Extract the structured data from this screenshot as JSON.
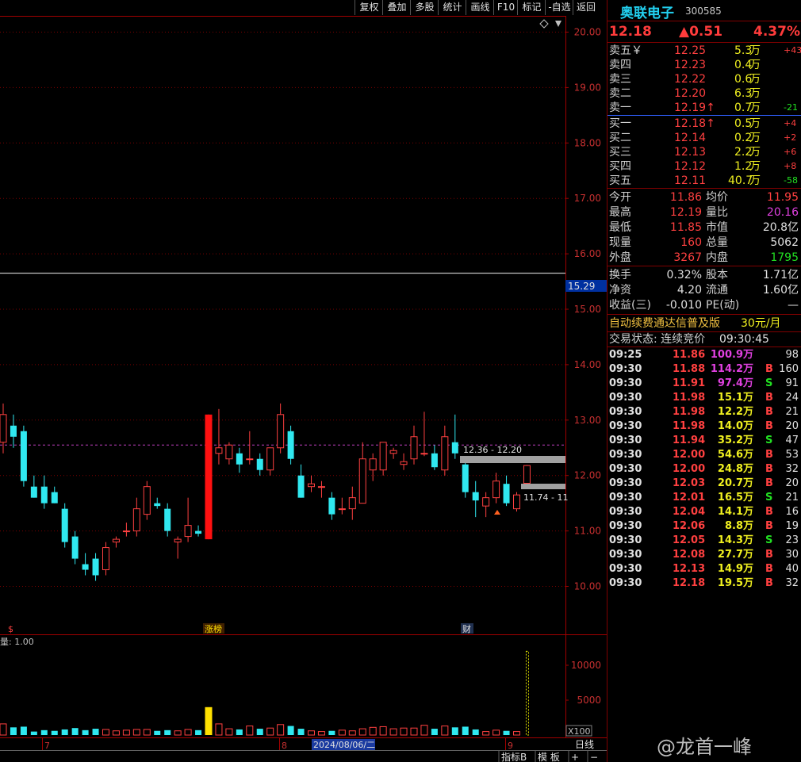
{
  "toolbar": {
    "buttons": [
      "复权",
      "叠加",
      "多股",
      "统计",
      "画线",
      "F10",
      "标记",
      "-自选",
      "返回"
    ]
  },
  "stock": {
    "name": "奥联电子",
    "code": "300585",
    "price": "12.18",
    "change": "▲0.51",
    "pct": "4.37%"
  },
  "orderbook": {
    "sell": [
      {
        "label": "卖五￥",
        "price": "12.25",
        "vol": "5.3",
        "unit": "万",
        "chg": "+43"
      },
      {
        "label": "卖四",
        "price": "12.23",
        "vol": "0.4",
        "unit": "万",
        "chg": ""
      },
      {
        "label": "卖三",
        "price": "12.22",
        "vol": "0.6",
        "unit": "万",
        "chg": ""
      },
      {
        "label": "卖二",
        "price": "12.20",
        "vol": "6.3",
        "unit": "万",
        "chg": ""
      },
      {
        "label": "卖一",
        "price": "12.19↑",
        "vol": "0.7",
        "unit": "万",
        "chg": "-21"
      }
    ],
    "buy": [
      {
        "label": "买一",
        "price": "12.18↑",
        "vol": "0.5",
        "unit": "万",
        "chg": "+4"
      },
      {
        "label": "买二",
        "price": "12.14",
        "vol": "0.2",
        "unit": "万",
        "chg": "+2"
      },
      {
        "label": "买三",
        "price": "12.13",
        "vol": "2.2",
        "unit": "万",
        "chg": "+6"
      },
      {
        "label": "买四",
        "price": "12.12",
        "vol": "1.2",
        "unit": "万",
        "chg": "+8"
      },
      {
        "label": "买五",
        "price": "12.11",
        "vol": "40.7",
        "unit": "万",
        "chg": "-58"
      }
    ]
  },
  "stats": [
    {
      "l1": "今开",
      "v1": "11.86",
      "c1": "red",
      "l2": "均价",
      "v2": "11.95",
      "c2": "red"
    },
    {
      "l1": "最高",
      "v1": "12.19",
      "c1": "red",
      "l2": "量比",
      "v2": "20.16",
      "c2": "mag"
    },
    {
      "l1": "最低",
      "v1": "11.85",
      "c1": "red",
      "l2": "市值",
      "v2": "20.8亿",
      "c2": "wht"
    },
    {
      "l1": "现量",
      "v1": "160",
      "c1": "red",
      "l2": "总量",
      "v2": "5062",
      "c2": "wht"
    },
    {
      "l1": "外盘",
      "v1": "3267",
      "c1": "red",
      "l2": "内盘",
      "v2": "1795",
      "c2": "green"
    }
  ],
  "stats2": [
    {
      "l1": "换手",
      "v1": "0.32%",
      "l2": "股本",
      "v2": "1.71亿"
    },
    {
      "l1": "净资",
      "v1": "4.20",
      "l2": "流通",
      "v2": "1.60亿"
    },
    {
      "l1": "收益(三)",
      "v1": "-0.010",
      "l2": "PE(动)",
      "v2": "—"
    }
  ],
  "promo": {
    "text": "自动续费通达信普及版",
    "price": "30元/月"
  },
  "trade_status": {
    "label": "交易状态: 连续竞价",
    "time": "09:30:45"
  },
  "ticks": [
    {
      "t": "09:25",
      "p": "11.86",
      "v": "100.9",
      "u": "万",
      "bs": "",
      "n": "98",
      "vc": "mag"
    },
    {
      "t": "09:30",
      "p": "11.88",
      "v": "114.2",
      "u": "万",
      "bs": "B",
      "n": "160",
      "vc": "mag"
    },
    {
      "t": "09:30",
      "p": "11.91",
      "v": "97.4",
      "u": "万",
      "bs": "S",
      "n": "91",
      "vc": "mag"
    },
    {
      "t": "09:30",
      "p": "11.98",
      "v": "15.1",
      "u": "万",
      "bs": "B",
      "n": "24",
      "vc": "yel"
    },
    {
      "t": "09:30",
      "p": "11.98",
      "v": "12.2",
      "u": "万",
      "bs": "B",
      "n": "21",
      "vc": "yel"
    },
    {
      "t": "09:30",
      "p": "11.98",
      "v": "14.0",
      "u": "万",
      "bs": "B",
      "n": "20",
      "vc": "yel"
    },
    {
      "t": "09:30",
      "p": "11.94",
      "v": "35.2",
      "u": "万",
      "bs": "S",
      "n": "47",
      "vc": "yel"
    },
    {
      "t": "09:30",
      "p": "12.00",
      "v": "54.6",
      "u": "万",
      "bs": "B",
      "n": "53",
      "vc": "yel"
    },
    {
      "t": "09:30",
      "p": "12.00",
      "v": "24.8",
      "u": "万",
      "bs": "B",
      "n": "32",
      "vc": "yel"
    },
    {
      "t": "09:30",
      "p": "12.03",
      "v": "20.7",
      "u": "万",
      "bs": "B",
      "n": "20",
      "vc": "yel"
    },
    {
      "t": "09:30",
      "p": "12.01",
      "v": "16.5",
      "u": "万",
      "bs": "S",
      "n": "21",
      "vc": "yel"
    },
    {
      "t": "09:30",
      "p": "12.04",
      "v": "14.1",
      "u": "万",
      "bs": "B",
      "n": "16",
      "vc": "yel"
    },
    {
      "t": "09:30",
      "p": "12.06",
      "v": "8.8",
      "u": "万",
      "bs": "B",
      "n": "19",
      "vc": "yel"
    },
    {
      "t": "09:30",
      "p": "12.05",
      "v": "14.3",
      "u": "万",
      "bs": "S",
      "n": "23",
      "vc": "yel"
    },
    {
      "t": "09:30",
      "p": "12.08",
      "v": "27.7",
      "u": "万",
      "bs": "B",
      "n": "30",
      "vc": "yel"
    },
    {
      "t": "09:30",
      "p": "12.13",
      "v": "14.9",
      "u": "万",
      "bs": "B",
      "n": "40",
      "vc": "yel"
    },
    {
      "t": "09:30",
      "p": "12.18",
      "v": "19.5",
      "u": "万",
      "bs": "B",
      "n": "32",
      "vc": "yel"
    }
  ],
  "chart_labels": {
    "current_marker": "15.29",
    "range_top": "12.36 - 12.20",
    "range_bottom": "11.74 - 11",
    "vol_label": "量: 1.00",
    "x100": "X100",
    "tag_s": "$",
    "tag_zhangting": "涨榜",
    "tag_cai": "财",
    "date_7": "7",
    "date_8": "8",
    "date_sel": "2024/08/06/二",
    "date_9": "9",
    "period": "日线",
    "bottom_buttons": [
      "指标B",
      "模 板",
      "+",
      "−"
    ]
  },
  "watermark": "@龙首一峰",
  "colors": {
    "up": "#ff3030",
    "down": "#30e8f0",
    "bg": "#000000",
    "grid": "#7a0000"
  },
  "chart_data": {
    "type": "candlestick",
    "price_axis": {
      "ticks": [
        20.0,
        19.0,
        18.0,
        17.0,
        16.0,
        15.0,
        14.0,
        13.0,
        12.0,
        11.0,
        10.0
      ],
      "range": [
        9.8,
        20.2
      ]
    },
    "volume_axis": {
      "ticks": [
        10000,
        5000
      ],
      "range": [
        0,
        13000
      ]
    },
    "candles": [
      {
        "o": 12.6,
        "h": 13.3,
        "l": 12.4,
        "c": 13.1
      },
      {
        "o": 12.9,
        "h": 13.1,
        "l": 12.5,
        "c": 12.7
      },
      {
        "o": 12.8,
        "h": 12.9,
        "l": 11.8,
        "c": 11.9
      },
      {
        "o": 11.8,
        "h": 12.0,
        "l": 11.6,
        "c": 11.6
      },
      {
        "o": 11.8,
        "h": 12.0,
        "l": 11.4,
        "c": 11.5
      },
      {
        "o": 11.7,
        "h": 11.8,
        "l": 11.5,
        "c": 11.5
      },
      {
        "o": 11.4,
        "h": 11.5,
        "l": 10.7,
        "c": 10.8
      },
      {
        "o": 10.9,
        "h": 11.0,
        "l": 10.4,
        "c": 10.5
      },
      {
        "o": 10.4,
        "h": 10.6,
        "l": 10.2,
        "c": 10.3
      },
      {
        "o": 10.5,
        "h": 10.6,
        "l": 10.1,
        "c": 10.2
      },
      {
        "o": 10.3,
        "h": 10.8,
        "l": 10.2,
        "c": 10.7
      },
      {
        "o": 10.8,
        "h": 10.9,
        "l": 10.7,
        "c": 10.85
      },
      {
        "o": 11.0,
        "h": 11.15,
        "l": 10.9,
        "c": 11.0
      },
      {
        "o": 11.0,
        "h": 11.6,
        "l": 10.9,
        "c": 11.4
      },
      {
        "o": 11.3,
        "h": 11.9,
        "l": 11.2,
        "c": 11.8
      },
      {
        "o": 11.5,
        "h": 11.6,
        "l": 11.4,
        "c": 11.45
      },
      {
        "o": 11.4,
        "h": 11.5,
        "l": 10.9,
        "c": 11.0
      },
      {
        "o": 10.8,
        "h": 10.9,
        "l": 10.5,
        "c": 10.85
      },
      {
        "o": 10.9,
        "h": 11.6,
        "l": 10.8,
        "c": 11.1
      },
      {
        "o": 11.0,
        "h": 11.1,
        "l": 10.9,
        "c": 10.95
      },
      {
        "o": 10.85,
        "h": 13.1,
        "l": 10.85,
        "c": 13.1
      },
      {
        "o": 12.4,
        "h": 13.2,
        "l": 12.2,
        "c": 12.5
      },
      {
        "o": 12.3,
        "h": 12.6,
        "l": 12.2,
        "c": 12.55
      },
      {
        "o": 12.4,
        "h": 12.5,
        "l": 12.05,
        "c": 12.2
      },
      {
        "o": 12.3,
        "h": 12.8,
        "l": 12.2,
        "c": 12.3
      },
      {
        "o": 12.3,
        "h": 12.4,
        "l": 12.0,
        "c": 12.1
      },
      {
        "o": 12.1,
        "h": 12.5,
        "l": 12.0,
        "c": 12.5
      },
      {
        "o": 12.5,
        "h": 13.3,
        "l": 12.4,
        "c": 13.1
      },
      {
        "o": 12.8,
        "h": 12.9,
        "l": 12.2,
        "c": 12.3
      },
      {
        "o": 12.0,
        "h": 12.2,
        "l": 11.6,
        "c": 11.6
      },
      {
        "o": 11.8,
        "h": 12.0,
        "l": 11.7,
        "c": 11.85
      },
      {
        "o": 11.8,
        "h": 11.9,
        "l": 11.6,
        "c": 11.8
      },
      {
        "o": 11.6,
        "h": 11.7,
        "l": 11.2,
        "c": 11.3
      },
      {
        "o": 11.4,
        "h": 11.6,
        "l": 11.3,
        "c": 11.4
      },
      {
        "o": 11.4,
        "h": 11.8,
        "l": 11.2,
        "c": 11.6
      },
      {
        "o": 11.5,
        "h": 12.6,
        "l": 11.5,
        "c": 12.3
      },
      {
        "o": 12.1,
        "h": 12.4,
        "l": 11.9,
        "c": 12.3
      },
      {
        "o": 12.1,
        "h": 12.6,
        "l": 12.0,
        "c": 12.6
      },
      {
        "o": 12.4,
        "h": 12.5,
        "l": 12.3,
        "c": 12.45
      },
      {
        "o": 12.2,
        "h": 12.4,
        "l": 12.1,
        "c": 12.25
      },
      {
        "o": 12.3,
        "h": 12.9,
        "l": 12.2,
        "c": 12.7
      },
      {
        "o": 12.4,
        "h": 13.15,
        "l": 12.35,
        "c": 12.4
      },
      {
        "o": 12.4,
        "h": 12.55,
        "l": 12.1,
        "c": 12.15
      },
      {
        "o": 12.1,
        "h": 12.9,
        "l": 12.0,
        "c": 12.7
      },
      {
        "o": 12.6,
        "h": 13.1,
        "l": 12.3,
        "c": 12.4
      },
      {
        "o": 12.2,
        "h": 12.3,
        "l": 11.6,
        "c": 11.7
      },
      {
        "o": 11.7,
        "h": 11.9,
        "l": 11.25,
        "c": 11.55
      },
      {
        "o": 11.45,
        "h": 11.7,
        "l": 11.25,
        "c": 11.6
      },
      {
        "o": 11.6,
        "h": 12.05,
        "l": 11.5,
        "c": 11.9
      },
      {
        "o": 11.85,
        "h": 12.0,
        "l": 11.45,
        "c": 11.5
      },
      {
        "o": 11.4,
        "h": 11.7,
        "l": 11.35,
        "c": 11.65
      },
      {
        "o": 11.86,
        "h": 12.19,
        "l": 11.85,
        "c": 12.18
      }
    ],
    "volumes": [
      1600,
      1100,
      1200,
      500,
      700,
      600,
      800,
      1000,
      700,
      900,
      800,
      600,
      700,
      800,
      800,
      600,
      700,
      600,
      800,
      700,
      4000,
      1600,
      900,
      800,
      1300,
      900,
      1000,
      1500,
      1300,
      900,
      600,
      500,
      600,
      700,
      600,
      900,
      1100,
      1200,
      900,
      1000,
      1000,
      1400,
      900,
      1300,
      1100,
      1200,
      800,
      500,
      700,
      600,
      500,
      12000
    ]
  }
}
